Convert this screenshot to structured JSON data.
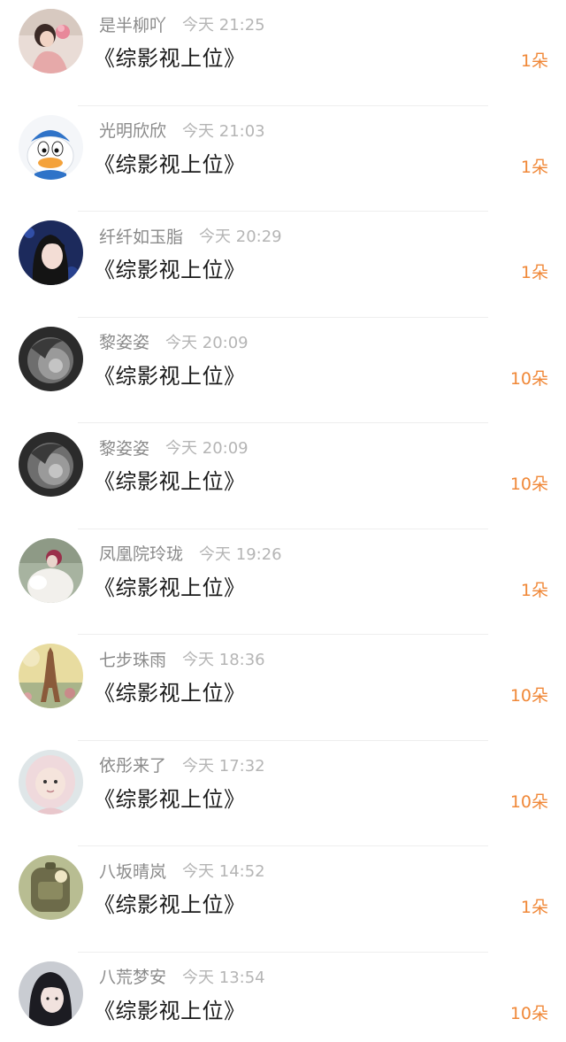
{
  "colors": {
    "count": "#f08838",
    "name": "#8a8a8a",
    "time": "#b5b5b5",
    "title": "#1a1a1a"
  },
  "items": [
    {
      "name": "是半柳吖",
      "time": "今天 21:25",
      "title": "《综影视上位》",
      "count": "1朵",
      "avatar": "girl-pink-avatar"
    },
    {
      "name": "光明欣欣",
      "time": "今天 21:03",
      "title": "《综影视上位》",
      "count": "1朵",
      "avatar": "donald-duck-avatar"
    },
    {
      "name": "纤纤如玉脂",
      "time": "今天 20:29",
      "title": "《综影视上位》",
      "count": "1朵",
      "avatar": "girl-dark-hair-avatar"
    },
    {
      "name": "黎姿姿",
      "time": "今天 20:09",
      "title": "《综影视上位》",
      "count": "10朵",
      "avatar": "grayscale-portrait-avatar"
    },
    {
      "name": "黎姿姿",
      "time": "今天 20:09",
      "title": "《综影视上位》",
      "count": "10朵",
      "avatar": "grayscale-portrait-avatar"
    },
    {
      "name": "凤凰院玲珑",
      "time": "今天 19:26",
      "title": "《综影视上位》",
      "count": "1朵",
      "avatar": "white-fur-avatar"
    },
    {
      "name": "七步珠雨",
      "time": "今天 18:36",
      "title": "《综影视上位》",
      "count": "10朵",
      "avatar": "eiffel-tower-avatar"
    },
    {
      "name": "依彤来了",
      "time": "今天 17:32",
      "title": "《综影视上位》",
      "count": "10朵",
      "avatar": "baby-hood-avatar"
    },
    {
      "name": "八坂晴岚",
      "time": "今天 14:52",
      "title": "《综影视上位》",
      "count": "1朵",
      "avatar": "backpack-avatar"
    },
    {
      "name": "八荒梦安",
      "time": "今天 13:54",
      "title": "《综影视上位》",
      "count": "10朵",
      "avatar": "girl-bangs-avatar"
    }
  ]
}
